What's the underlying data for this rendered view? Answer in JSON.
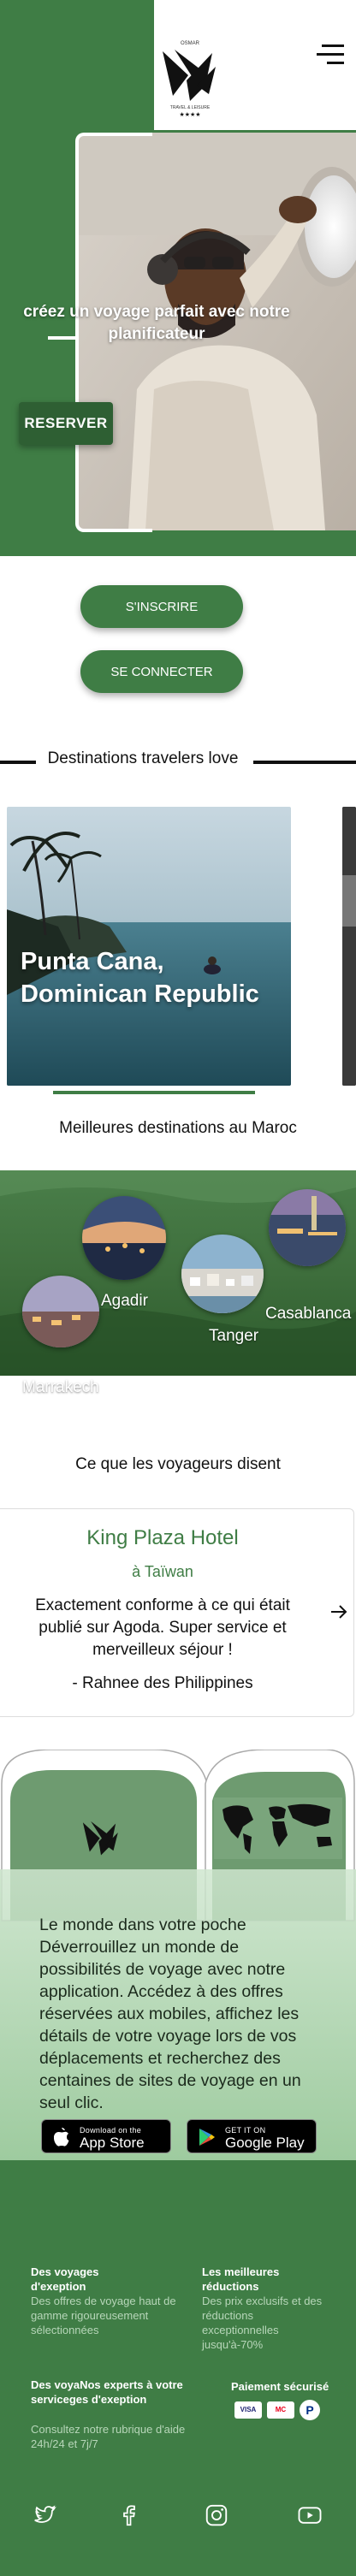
{
  "brand": {
    "logo_subtitle": "TRAVEL & LEISURE",
    "logo_top": "OSMAR"
  },
  "hero": {
    "title": "créez un voyage parfait avec notre planificateur",
    "reserve_label": "RESERVER"
  },
  "auth": {
    "signup_label": "S'INSCRIRE",
    "login_label": "SE CONNECTER"
  },
  "destinations": {
    "heading": "Destinations travelers love",
    "cards": [
      {
        "name": "Punta Cana, Dominican Republic"
      }
    ]
  },
  "morocco": {
    "heading": "Meilleures destinations au Maroc",
    "cities": [
      "Agadir",
      "Tanger",
      "Casablanca",
      "Marrakech"
    ]
  },
  "reviews": {
    "heading": "Ce que les voyageurs disent",
    "items": [
      {
        "hotel": "King Plaza Hotel",
        "location": "à Taïwan",
        "text": "Exactement conforme à ce qui était publié sur Agoda. Super service et merveilleux séjour !",
        "author": "- Rahnee des Philippines"
      }
    ]
  },
  "app": {
    "text": "Le monde dans votre poche Déverrouillez un monde de possibilités de voyage avec notre application. Accédez à des offres réservées aux mobiles, affichez les détails de votre voyage lors de vos déplacements et recherchez des centaines de sites de voyage en un seul clic.",
    "app_store": {
      "small": "Download on the",
      "big": "App Store"
    },
    "google_play": {
      "small": "GET IT ON",
      "big": "Google Play"
    }
  },
  "footer": {
    "col1_title": "Des voyages d'exeption",
    "col1_text": "Des offres de voyage haut de gamme rigoureusement sélectionnées",
    "col2_title": "Les meilleures réductions",
    "col2_text": "Des prix exclusifs et des réductions exceptionnelles jusqu'à-70%",
    "col3_title": "Des voyaNos experts à votre serviceges d'exeption",
    "col3_text": "Consultez notre rubrique d'aide 24h/24 et 7j/7",
    "col4_title": "Paiement sécurisé",
    "payments": [
      "VISA",
      "MC",
      "P"
    ]
  },
  "social": [
    "twitter-icon",
    "facebook-icon",
    "instagram-icon",
    "youtube-icon"
  ],
  "colors": {
    "brand_green": "#3f7d45",
    "dark_green": "#2e5f33",
    "light_green": "#b7d6b9"
  }
}
